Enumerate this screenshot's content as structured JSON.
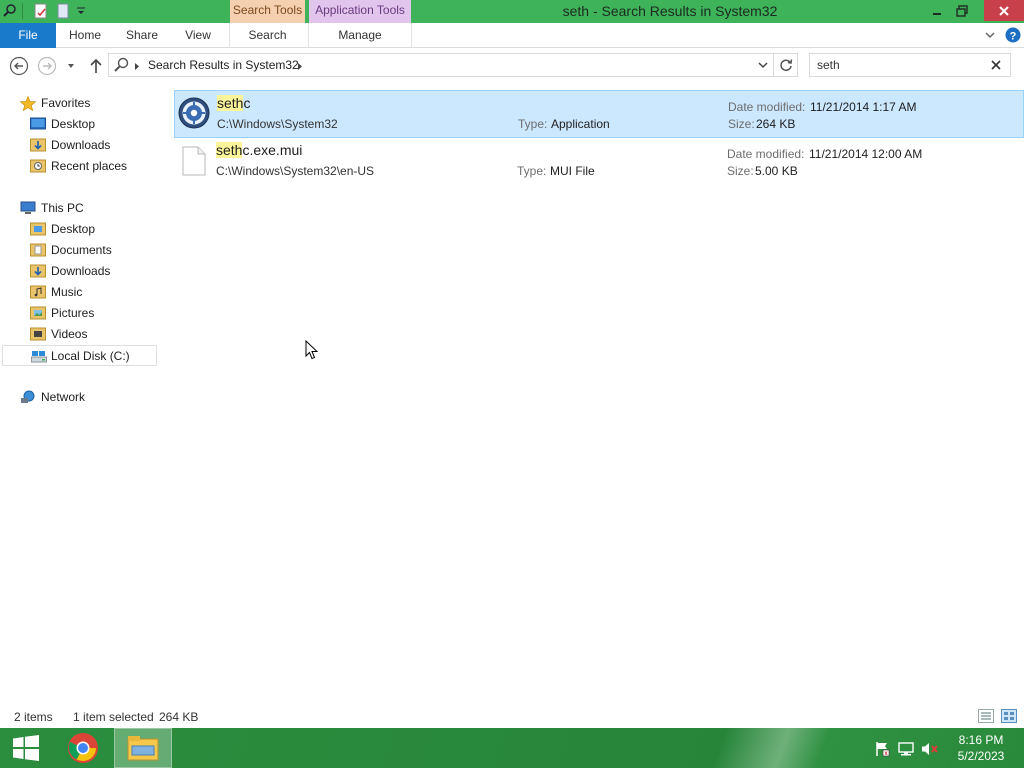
{
  "window": {
    "title": "seth - Search Results in System32",
    "context_tabs": {
      "search_tools": "Search Tools",
      "application_tools": "Application Tools"
    }
  },
  "ribbon": {
    "tabs": [
      "File",
      "Home",
      "Share",
      "View",
      "Search",
      "Manage"
    ]
  },
  "address": {
    "breadcrumb": "Search Results in System32"
  },
  "search": {
    "query": "seth"
  },
  "nav": {
    "favorites": "Favorites",
    "favorites_items": [
      "Desktop",
      "Downloads",
      "Recent places"
    ],
    "this_pc": "This PC",
    "pc_items": [
      "Desktop",
      "Documents",
      "Downloads",
      "Music",
      "Pictures",
      "Videos",
      "Local Disk (C:)"
    ],
    "network": "Network"
  },
  "results": [
    {
      "name_highlight": "seth",
      "name_rest": "c",
      "path": "C:\\Windows\\System32",
      "type_label": "Type:",
      "type": "Application",
      "date_label": "Date modified:",
      "date": "11/21/2014 1:17 AM",
      "size_label": "Size:",
      "size": "264 KB",
      "selected": true
    },
    {
      "name_highlight": "seth",
      "name_rest": "c.exe.mui",
      "path": "C:\\Windows\\System32\\en-US",
      "type_label": "Type:",
      "type": "MUI File",
      "date_label": "Date modified:",
      "date": "11/21/2014 12:00 AM",
      "size_label": "Size:",
      "size": "5.00 KB",
      "selected": false
    }
  ],
  "status": {
    "items": "2 items",
    "selected": "1 item selected",
    "size": "264 KB"
  },
  "taskbar": {
    "time": "8:16 PM",
    "date": "5/2/2023"
  },
  "colors": {
    "title_bar": "#3eb35a",
    "file_tab": "#1979ca",
    "selection": "#cce8ff",
    "highlight": "#fbf59a",
    "close": "#c7404a"
  }
}
